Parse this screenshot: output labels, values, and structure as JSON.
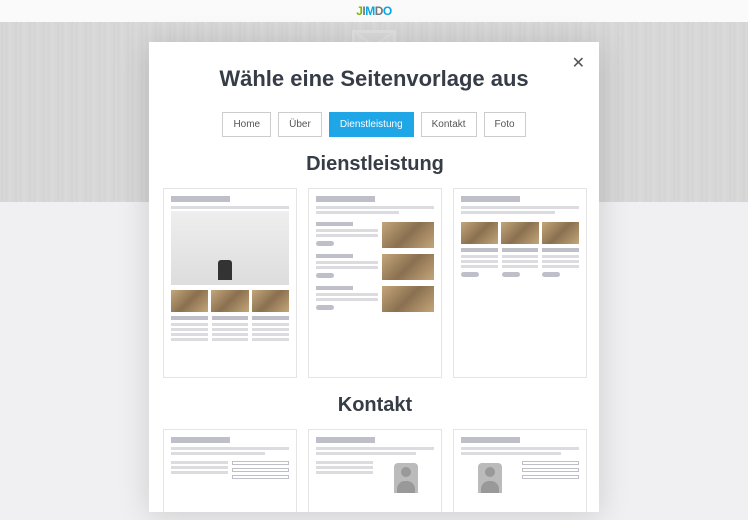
{
  "logo": {
    "c1": "J",
    "c2": "I",
    "c3": "M",
    "c4": "D",
    "c5": "O"
  },
  "modal": {
    "title": "Wähle eine Seitenvorlage aus",
    "filters": [
      {
        "id": "home",
        "label": "Home",
        "active": false
      },
      {
        "id": "ueber",
        "label": "Über",
        "active": false
      },
      {
        "id": "dienstleistung",
        "label": "Dienstleistung",
        "active": true
      },
      {
        "id": "kontakt",
        "label": "Kontakt",
        "active": false
      },
      {
        "id": "foto",
        "label": "Foto",
        "active": false
      }
    ],
    "sections": [
      {
        "id": "dienstleistung",
        "title": "Dienstleistung"
      },
      {
        "id": "kontakt",
        "title": "Kontakt"
      }
    ]
  }
}
